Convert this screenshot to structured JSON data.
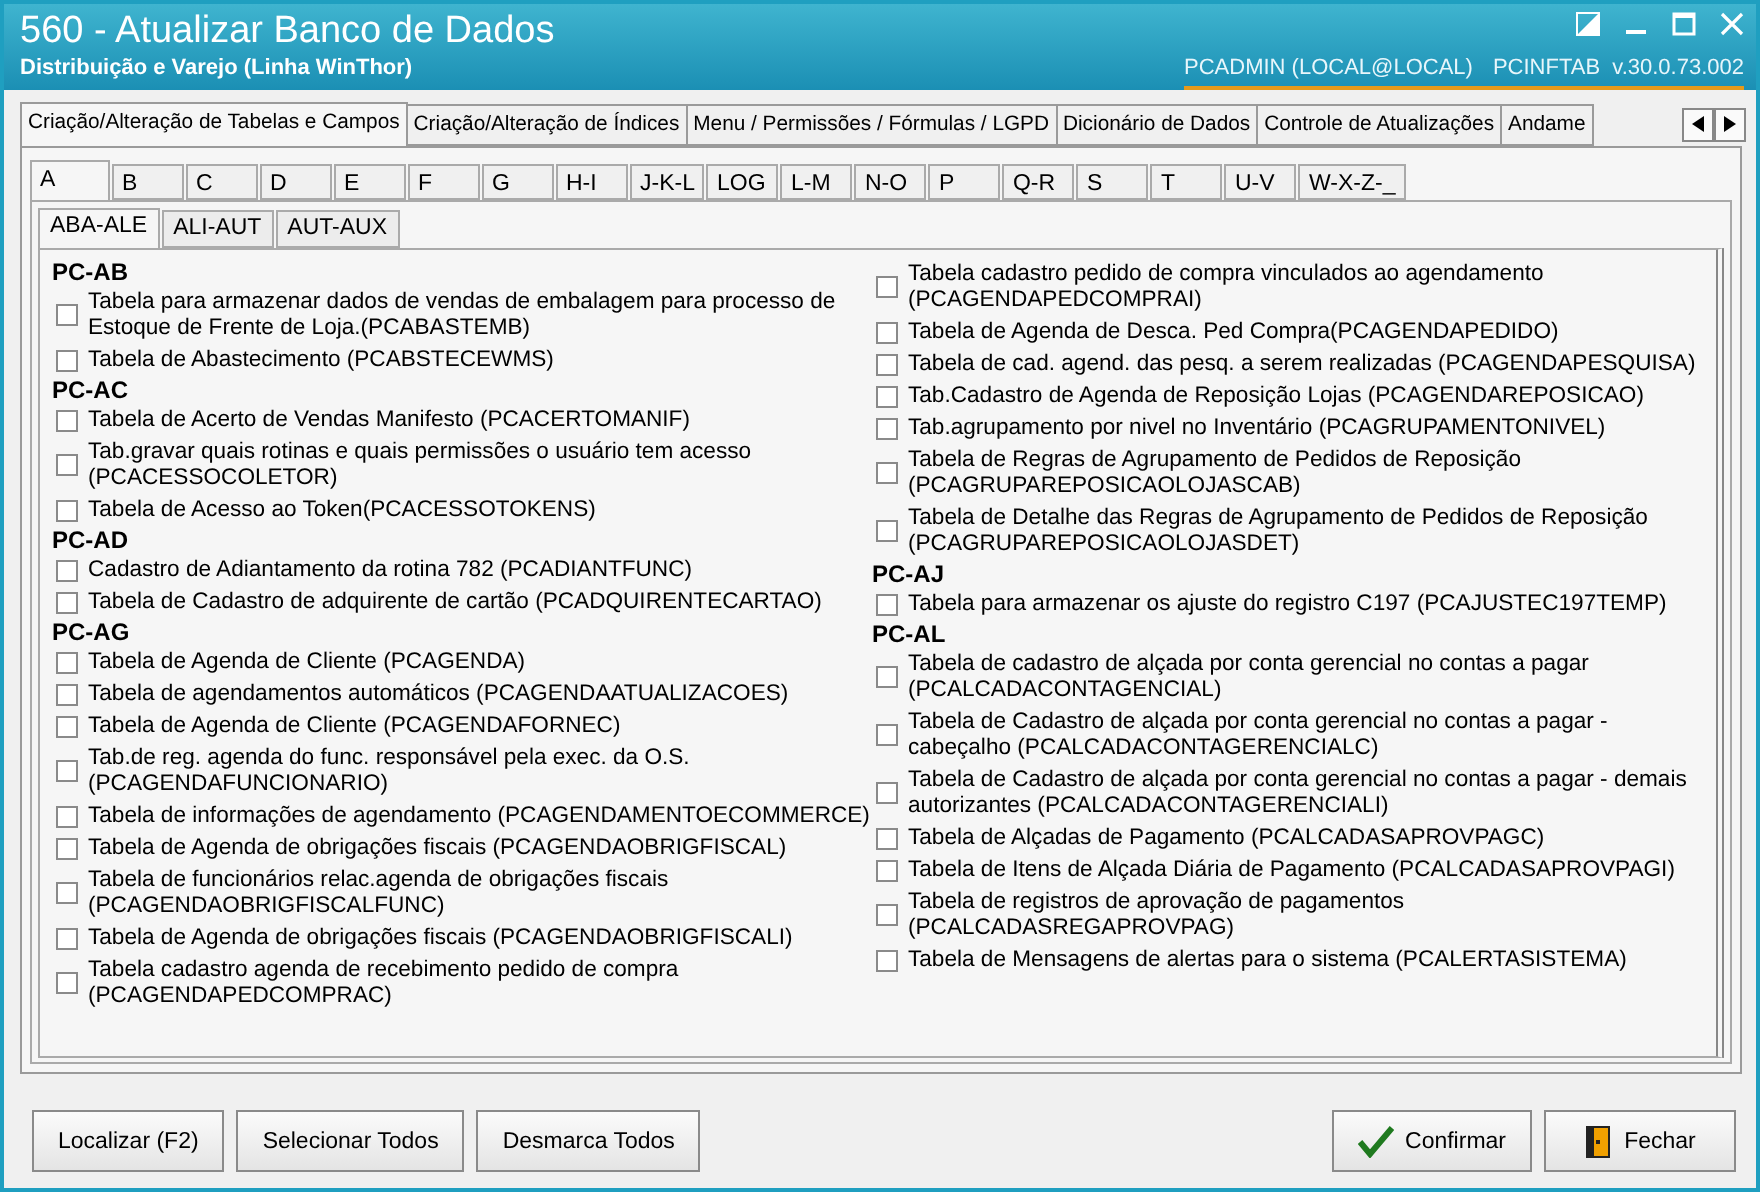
{
  "window": {
    "title": "560 - Atualizar Banco de Dados",
    "subtitle": "Distribuição e Varejo (Linha WinThor)",
    "user": "PCADMIN (LOCAL@LOCAL)",
    "version": "PCINFTAB  v.30.0.73.002"
  },
  "main_tabs": [
    {
      "label": "Criação/Alteração de Tabelas e Campos",
      "selected": true
    },
    {
      "label": "Criação/Alteração de Índices",
      "selected": false
    },
    {
      "label": "Menu / Permissões / Fórmulas / LGPD",
      "selected": false
    },
    {
      "label": "Dicionário de Dados",
      "selected": false
    },
    {
      "label": "Controle de Atualizações",
      "selected": false
    },
    {
      "label": "Andame",
      "selected": false
    }
  ],
  "letter_tabs": [
    {
      "label": "A",
      "selected": true
    },
    {
      "label": "B",
      "selected": false
    },
    {
      "label": "C",
      "selected": false
    },
    {
      "label": "D",
      "selected": false
    },
    {
      "label": "E",
      "selected": false
    },
    {
      "label": "F",
      "selected": false
    },
    {
      "label": "G",
      "selected": false
    },
    {
      "label": "H-I",
      "selected": false
    },
    {
      "label": "J-K-L",
      "selected": false
    },
    {
      "label": "LOG",
      "selected": false
    },
    {
      "label": "L-M",
      "selected": false
    },
    {
      "label": "N-O",
      "selected": false
    },
    {
      "label": "P",
      "selected": false
    },
    {
      "label": "Q-R",
      "selected": false
    },
    {
      "label": "S",
      "selected": false
    },
    {
      "label": "T",
      "selected": false
    },
    {
      "label": "U-V",
      "selected": false
    },
    {
      "label": "W-X-Z-_",
      "selected": false
    }
  ],
  "sub_tabs": [
    {
      "label": "ABA-ALE",
      "selected": true
    },
    {
      "label": "ALI-AUT",
      "selected": false
    },
    {
      "label": "AUT-AUX",
      "selected": false
    }
  ],
  "columns": [
    [
      {
        "header": "PC-AB",
        "items": [
          {
            "label": "Tabela para armazenar dados de vendas de embalagem para processo de Estoque de Frente de Loja.(PCABASTEMB)",
            "checked": false
          },
          {
            "label": "Tabela de Abastecimento (PCABSTECEWMS)",
            "checked": false
          }
        ]
      },
      {
        "header": "PC-AC",
        "items": [
          {
            "label": "Tabela de Acerto de Vendas Manifesto (PCACERTOMANIF)",
            "checked": false
          },
          {
            "label": "Tab.gravar quais rotinas e quais permissões o usuário tem acesso (PCACESSOCOLETOR)",
            "checked": false
          },
          {
            "label": "Tabela de Acesso ao Token(PCACESSOTOKENS)",
            "checked": false
          }
        ]
      },
      {
        "header": "PC-AD",
        "items": [
          {
            "label": "Cadastro de Adiantamento da rotina 782 (PCADIANTFUNC)",
            "checked": false
          },
          {
            "label": "Tabela de Cadastro de adquirente de cartão (PCADQUIRENTECARTAO)",
            "checked": false
          }
        ]
      },
      {
        "header": "PC-AG",
        "items": [
          {
            "label": "Tabela  de Agenda de Cliente (PCAGENDA)",
            "checked": false
          },
          {
            "label": "Tabela de agendamentos automáticos (PCAGENDAATUALIZACOES)",
            "checked": false
          },
          {
            "label": "Tabela  de Agenda de Cliente (PCAGENDAFORNEC)",
            "checked": false
          },
          {
            "label": "Tab.de reg. agenda do func. responsável pela exec. da O.S. (PCAGENDAFUNCIONARIO)",
            "checked": false
          },
          {
            "label": "Tabela de informações de agendamento (PCAGENDAMENTOECOMMERCE)",
            "checked": false
          },
          {
            "label": "Tabela de Agenda de obrigações fiscais (PCAGENDAOBRIGFISCAL)",
            "checked": false
          },
          {
            "label": "Tabela de funcionários relac.agenda de obrigações fiscais (PCAGENDAOBRIGFISCALFUNC)",
            "checked": false
          },
          {
            "label": "Tabela de Agenda de obrigações fiscais (PCAGENDAOBRIGFISCALI)",
            "checked": false
          },
          {
            "label": "Tabela cadastro agenda de recebimento pedido de compra (PCAGENDAPEDCOMPRAC)",
            "checked": false
          }
        ]
      }
    ],
    [
      {
        "items": [
          {
            "label": "Tabela cadastro pedido de compra vinculados ao agendamento (PCAGENDAPEDCOMPRAI)",
            "checked": false
          },
          {
            "label": "Tabela  de Agenda de Desca. Ped Compra(PCAGENDAPEDIDO)",
            "checked": false
          },
          {
            "label": "Tabela de cad. agend. das pesq. a serem realizadas (PCAGENDAPESQUISA)",
            "checked": false
          },
          {
            "label": "Tab.Cadastro de Agenda de Reposição Lojas (PCAGENDAREPOSICAO)",
            "checked": false
          },
          {
            "label": "Tab.agrupamento por nivel no Inventário (PCAGRUPAMENTONIVEL)",
            "checked": false
          },
          {
            "label": "Tabela de Regras de Agrupamento de Pedidos de Reposição (PCAGRUPAREPOSICAOLOJASCAB)",
            "checked": false
          },
          {
            "label": "Tabela de Detalhe das Regras de Agrupamento de Pedidos de Reposição (PCAGRUPAREPOSICAOLOJASDET)",
            "checked": false
          }
        ]
      },
      {
        "header": "PC-AJ",
        "items": [
          {
            "label": "Tabela para armazenar os ajuste do registro C197 (PCAJUSTEC197TEMP)",
            "checked": false
          }
        ]
      },
      {
        "header": "PC-AL",
        "items": [
          {
            "label": "Tabela de cadastro de alçada por conta gerencial no contas a pagar (PCALCADACONTAGENCIAL)",
            "checked": false
          },
          {
            "label": "Tabela de Cadastro de alçada por conta gerencial no contas a pagar - cabeçalho (PCALCADACONTAGERENCIALC)",
            "checked": false
          },
          {
            "label": "Tabela de Cadastro de alçada por conta gerencial no contas a pagar - demais autorizantes (PCALCADACONTAGERENCIALI)",
            "checked": false
          },
          {
            "label": "Tabela de Alçadas de Pagamento (PCALCADASAPROVPAGC)",
            "checked": false
          },
          {
            "label": "Tabela de Itens de Alçada Diária de Pagamento (PCALCADASAPROVPAGI)",
            "checked": false
          },
          {
            "label": "Tabela de registros de aprovação de pagamentos (PCALCADASREGAPROVPAG)",
            "checked": false
          },
          {
            "label": "Tabela de Mensagens de alertas para o sistema (PCALERTASISTEMA)",
            "checked": false
          }
        ]
      }
    ]
  ],
  "buttons_left": [
    {
      "label": "Localizar (F2)"
    },
    {
      "label": "Selecionar Todos"
    },
    {
      "label": "Desmarca Todos"
    }
  ],
  "buttons_right": [
    {
      "label": "Confirmar",
      "kind": "confirm"
    },
    {
      "label": "Fechar",
      "kind": "exit"
    }
  ]
}
